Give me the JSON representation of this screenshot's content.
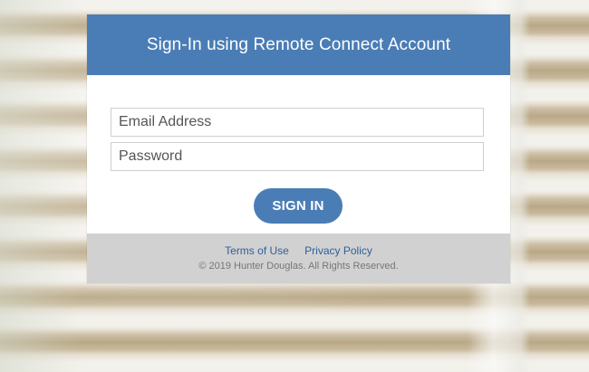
{
  "login": {
    "header_title": "Sign-In using Remote Connect Account",
    "email": {
      "placeholder": "Email Address",
      "value": ""
    },
    "password": {
      "placeholder": "Password",
      "value": ""
    },
    "submit_label": "SIGN IN"
  },
  "footer": {
    "links": [
      {
        "label": "Terms of Use"
      },
      {
        "label": "Privacy Policy"
      }
    ],
    "copyright": "© 2019 Hunter Douglas. All Rights Reserved."
  },
  "colors": {
    "accent": "#4a7db5",
    "footer_bg": "#d1d1d1",
    "link": "#2f5f9b"
  }
}
